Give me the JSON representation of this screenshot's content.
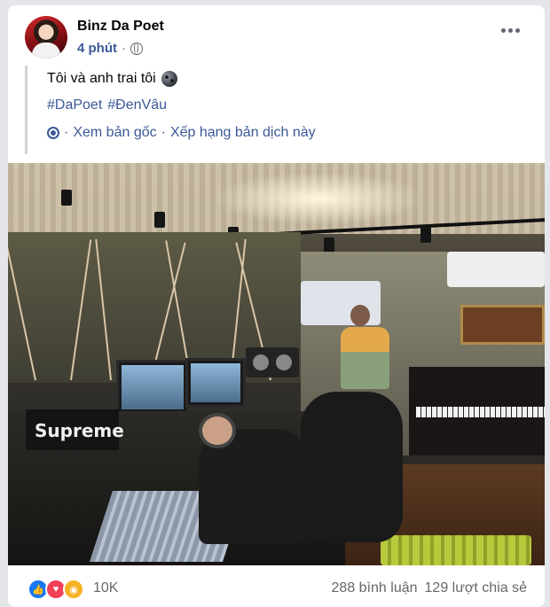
{
  "post": {
    "author": "Binz Da Poet",
    "time": "4 phút",
    "separator": "·",
    "text": "Tôi và anh trai tôi",
    "hashtags": [
      "#DaPoet",
      "#ĐenVâu"
    ],
    "translation": {
      "view_original": "Xem bản gốc",
      "separator": "·",
      "rate": "Xếp hạng bản dịch này"
    },
    "photo_text": "Supreme"
  },
  "footer": {
    "reaction_count": "10K",
    "comments": "288 bình luận",
    "shares": "129 lượt chia sẻ"
  },
  "colors": {
    "link": "#3b5998",
    "like": "#1877f2",
    "love": "#f33e58",
    "wow": "#f7b125"
  },
  "icons": [
    "globe-icon",
    "more-icon",
    "moon-emoji-icon",
    "gear-icon",
    "like-icon",
    "love-icon",
    "wow-icon"
  ]
}
